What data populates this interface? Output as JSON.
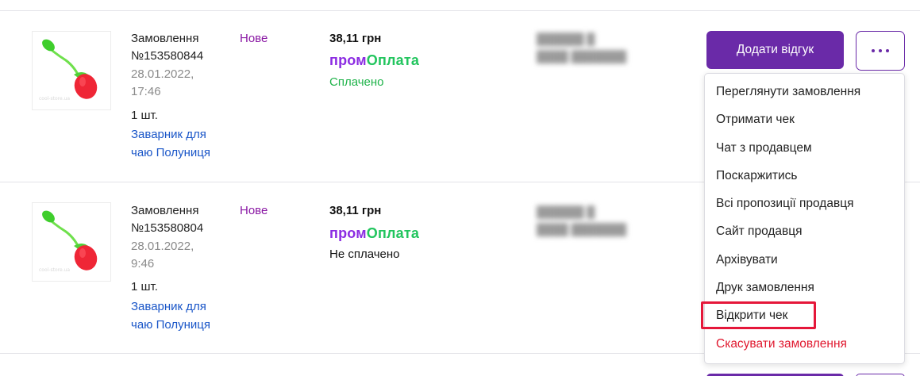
{
  "orders": [
    {
      "title_line1": "Замовлення",
      "title_line2": "№153580844",
      "date_line1": "28.01.2022,",
      "date_line2": "17:46",
      "quantity": "1 шт.",
      "product_line1": "Заварник для",
      "product_line2": "чаю Полуниця",
      "status": "Нове",
      "price": "38,11 грн",
      "payment_brand_part1": "пром",
      "payment_brand_part2": "Оплата",
      "payment_state": "Сплачено",
      "review_button": "Додати відгук"
    },
    {
      "title_line1": "Замовлення",
      "title_line2": "№153580804",
      "date_line1": "28.01.2022,",
      "date_line2": "9:46",
      "quantity": "1 шт.",
      "product_line1": "Заварник для",
      "product_line2": "чаю Полуниця",
      "status": "Нове",
      "price": "38,11 грн",
      "payment_brand_part1": "пром",
      "payment_brand_part2": "Оплата",
      "payment_state": "Не сплачено"
    }
  ],
  "dropdown_menu": [
    "Переглянути замовлення",
    "Отримати чек",
    "Чат з продавцем",
    "Поскаржитись",
    "Всі пропозиції продавця",
    "Сайт продавця",
    "Архівувати",
    "Друк замовлення",
    "Відкрити чек",
    "Скасувати замовлення"
  ],
  "highlighted_menu_item": "Відкрити чек",
  "icons": {
    "more": "more-dots-icon",
    "thumbnail": "strawberry-tea-infuser-image"
  },
  "colors": {
    "accent": "#6a2aa8",
    "status": "#8a18a4",
    "link": "#1a56c8",
    "paid": "#1fb34a",
    "danger": "#e0192f",
    "highlight": "#e5173a"
  }
}
